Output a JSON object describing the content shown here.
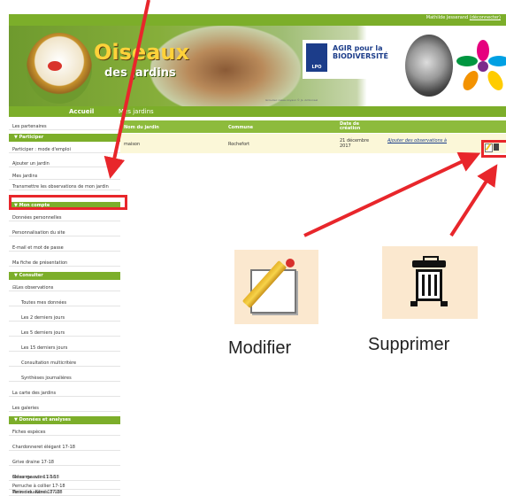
{
  "header": {
    "user_name": "Mathilde Jesserand",
    "logout_label": "(déconnecter)",
    "site_title": "Oiseaux",
    "site_subtitle": "des jardins",
    "partner_text_1": "AGIR pour la",
    "partner_text_2": "BIODIVERSITÉ",
    "partner_logo": "LPO",
    "photo_credit": "Gros-bec casse-noyaux © JL. Ambonsel"
  },
  "nav": {
    "home": "Accueil",
    "current": "Mes jardins"
  },
  "sidebar": {
    "partners": "Les partenaires",
    "sections": [
      {
        "title": "Participer",
        "items": [
          "Participer : mode d'emploi",
          "Ajouter un jardin",
          "Mes jardins",
          "Transmettre les observations de mon jardin"
        ]
      },
      {
        "title": "Mon compte",
        "items": [
          "Données personnelles",
          "Personnalisation du site",
          "E-mail et mot de passe",
          "Ma fiche de présentation"
        ]
      },
      {
        "title": "Consulter",
        "items": [
          "Les observations",
          "Toutes mes données",
          "Les 2 derniers jours",
          "Les 5 derniers jours",
          "Les 15 derniers jours",
          "Consultation multicritère",
          "Synthèses journalières",
          "La carte des jardins",
          "Les galeries"
        ]
      },
      {
        "title": "Données et analyses",
        "items": [
          "Fiches espèces",
          "Chardonneret élégant 17-18",
          "Grive draine 17-18",
          "Grive mauvis 17-18",
          "Pinson du Nord 17-18",
          "Mésange noire 17-18",
          "Perruche à collier 17-18",
          "Tarin des aulnes 17-18"
        ]
      }
    ]
  },
  "table": {
    "headers": [
      "Nom du jardin",
      "Commune",
      "Date de création"
    ],
    "rows": [
      {
        "name": "maison",
        "commune": "Rochefort",
        "date": "21 décembre 2017",
        "action": "Ajouter des observations à"
      }
    ]
  },
  "callouts": {
    "edit": "Modifier",
    "delete": "Supprimer"
  },
  "colors": {
    "accent_green": "#7cae2a",
    "highlight_red": "#e8262b",
    "row_bg": "#fbf7d8",
    "icon_bg": "#fbe8cf"
  },
  "icons": [
    "edit-icon",
    "trash-icon",
    "bird-mascot-icon",
    "lpo-logo-icon",
    "flower-logo-icon"
  ]
}
